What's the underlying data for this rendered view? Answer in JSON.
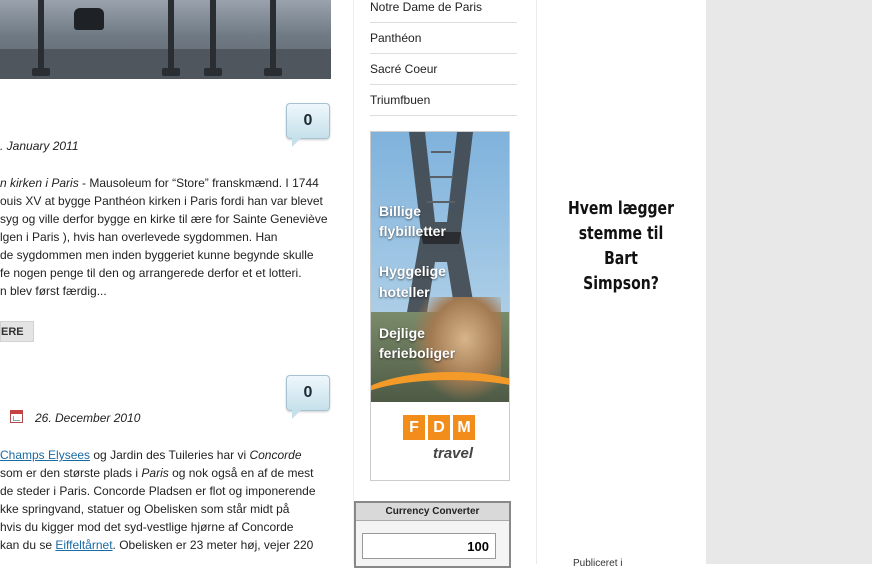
{
  "main": {
    "posts": [
      {
        "comment_count": "0",
        "date": ". January 2011",
        "excerpt_lines": [
          {
            "lead_italic": "n kirken i Paris",
            "text": " - Mausoleum for “Store” franskmænd. I 1744"
          },
          {
            "text": "ouis XV at bygge Panthéon kirken i Paris fordi han var blevet"
          },
          {
            "text": "syg og ville derfor bygge en kirke til ære for Sainte Geneviève"
          },
          {
            "text": "lgen i Paris ), hvis han overlevede sygdommen. Han"
          },
          {
            "text": "de sygdommen men inden byggeriet kunne begynde skulle"
          },
          {
            "text": "fe nogen penge til den og arrangerede derfor et et lotteri."
          },
          {
            "text": "n blev først færdig..."
          }
        ],
        "read_more_label": "ERE"
      },
      {
        "comment_count": "0",
        "date": "26. December 2010",
        "line1_link": "Champs Elysees",
        "line1_rest": " og Jardin des Tuileries har vi ",
        "line1_italic": "Concorde",
        "line2_a": " som er den største plads i ",
        "line2_italic": "Paris",
        "line2_b": " og nok også en af de mest",
        "line3": "de steder i Paris. Concorde Pladsen er flot og imponerende",
        "line4": "kke springvand, statuer og Obelisken som står midt på",
        "line5": " hvis du kigger mod det syd-vestlige hjørne af Concorde",
        "line6_a": "kan du se ",
        "line6_link": "Eiffeltårnet",
        "line6_b": ". Obelisken er 23 meter høj, vejer 220"
      }
    ]
  },
  "sidebar": {
    "links": [
      "Notre Dame de Paris",
      "Panthéon",
      "Sacré Coeur",
      "Triumfbuen"
    ],
    "ad": {
      "lines": [
        "Billige",
        "flybilletter",
        "Hyggelige",
        "hoteller",
        "Dejlige",
        "ferieboliger"
      ],
      "brand_letters": [
        "F",
        "D",
        "M"
      ],
      "brand_sub": "travel",
      "accent_color": "#f28c1b"
    },
    "currency_converter": {
      "title": "Currency Converter",
      "amount": "100"
    }
  },
  "right": {
    "promo_lines": [
      "Hvem lægger",
      "stemme til",
      "Bart",
      "Simpson?"
    ],
    "cut_text": "Publiceret i"
  }
}
